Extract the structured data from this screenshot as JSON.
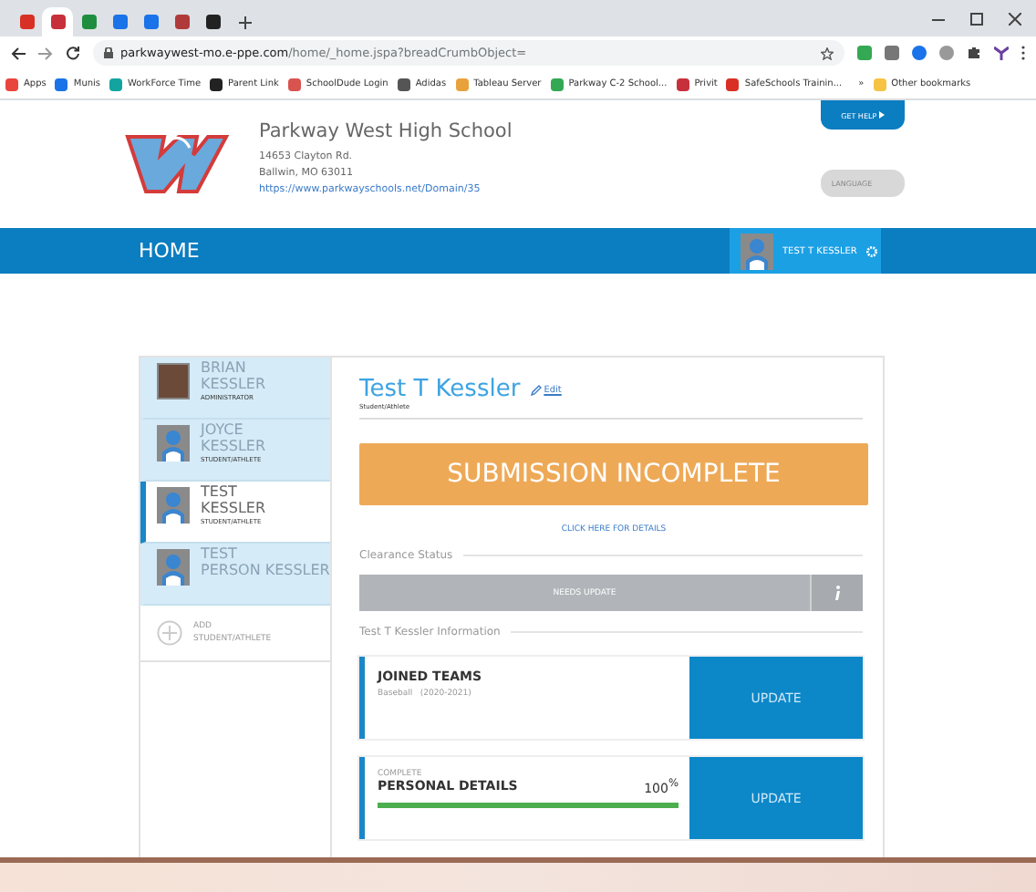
{
  "browser": {
    "tabs": [
      {
        "color": "#d93025",
        "selected": false
      },
      {
        "color": "#c7303a",
        "selected": true
      },
      {
        "color": "#1e8e3e",
        "selected": false
      },
      {
        "color": "#1a73e8",
        "selected": false
      },
      {
        "color": "#1a73e8",
        "selected": false
      },
      {
        "color": "#b03a3a",
        "selected": false
      },
      {
        "color": "#222222",
        "selected": false
      }
    ],
    "url_host": "parkwaywest-mo.e-ppe.com",
    "url_path": "/home/_home.jspa?breadCrumbObject=",
    "bookmarks": [
      {
        "label": "Apps",
        "color": "#e8453c"
      },
      {
        "label": "Munis",
        "color": "#1a73e8"
      },
      {
        "label": "WorkForce Time",
        "color": "#12a5a0"
      },
      {
        "label": "Parent Link",
        "color": "#222222"
      },
      {
        "label": "SchoolDude Login",
        "color": "#d9534f"
      },
      {
        "label": "Adidas",
        "color": "#555555"
      },
      {
        "label": "Tableau Server",
        "color": "#e8a23c"
      },
      {
        "label": "Parkway C-2 School...",
        "color": "#34a853"
      },
      {
        "label": "Privit",
        "color": "#c7303a"
      },
      {
        "label": "SafeSchools Trainin...",
        "color": "#d93025"
      }
    ],
    "overflow": "»",
    "other_bookmarks": "Other bookmarks"
  },
  "school": {
    "name": "Parkway West High School",
    "address_line_1": "14653 Clayton Rd.",
    "address_line_2": "Ballwin, MO 63011",
    "website": "https://www.parkwayschools.net/Domain/35",
    "help_button": "GET HELP",
    "language_button": "LANGUAGE"
  },
  "nav": {
    "home": "HOME",
    "user": "TEST T KESSLER"
  },
  "people": [
    {
      "kind": "photo",
      "first": "BRIAN",
      "last": "KESSLER",
      "role": "ADMINISTRATOR",
      "selected": false
    },
    {
      "kind": "avatar",
      "first": "JOYCE",
      "last": "KESSLER",
      "role": "STUDENT/ATHLETE",
      "selected": false
    },
    {
      "kind": "avatar",
      "first": "TEST",
      "last": "KESSLER",
      "role": "STUDENT/ATHLETE",
      "selected": true
    },
    {
      "kind": "avatar",
      "first": "TEST",
      "last": "PERSON KESSLER",
      "selected": false
    }
  ],
  "add_person": "ADD STUDENT/ATHLETE",
  "profile": {
    "name": "Test T Kessler",
    "edit": "Edit",
    "role": "Student/Athlete",
    "status": "SUBMISSION INCOMPLETE",
    "details_link": "CLICK HERE FOR DETAILS",
    "clearance_heading": "Clearance Status",
    "clearance": "NEEDS UPDATE",
    "info_heading": "Test T Kessler Information"
  },
  "sections": [
    {
      "kind": "list",
      "title": "JOINED TEAMS",
      "subtitle": "Baseball   (2020-2021)",
      "button": "UPDATE"
    },
    {
      "kind": "progress",
      "status": "COMPLETE",
      "title": "PERSONAL DETAILS",
      "percent": "100$^{%}$",
      "level": 1,
      "button": "UPDATE"
    }
  ]
}
